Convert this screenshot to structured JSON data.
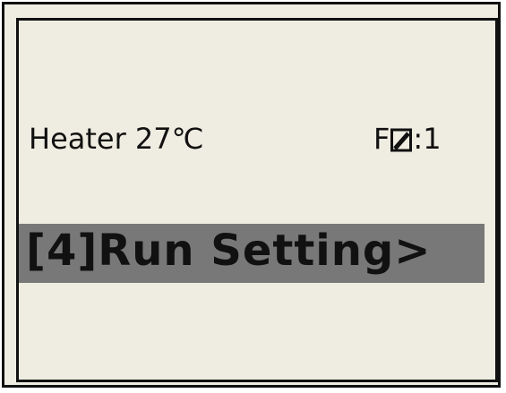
{
  "display": {
    "heater_status": "Heater 27℃",
    "fan_prefix": "F",
    "fan_suffix": ":1",
    "fan_icon": "slashed-box-icon",
    "menu_item": "[4]Run Setting>"
  },
  "colors": {
    "lcd_background": "#efece1",
    "highlight": "#787878",
    "text": "#111111"
  }
}
